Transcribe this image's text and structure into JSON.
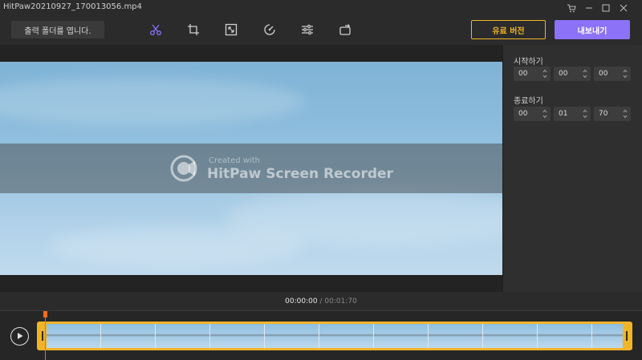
{
  "window": {
    "title": "HitPaw20210927_170013056.mp4",
    "cart_icon": "cart-icon",
    "minimize_icon": "minimize-icon",
    "maximize_icon": "maximize-icon",
    "close_icon": "close-icon"
  },
  "toolbar": {
    "open_folder_label": "출력 폴더를 엽니다.",
    "tools": [
      "cut-icon",
      "crop-icon",
      "resize-icon",
      "speed-icon",
      "adjust-icon",
      "rotate-icon"
    ],
    "active_tool": "cut-icon",
    "pro_label": "유료 버전",
    "export_label": "내보내기"
  },
  "preview": {
    "watermark_small": "Created with",
    "watermark_big": "HitPaw Screen Recorder"
  },
  "trim": {
    "start_label": "시작하기",
    "start": [
      "00",
      "00",
      "00"
    ],
    "end_label": "종료하기",
    "end": [
      "00",
      "01",
      "70"
    ]
  },
  "timecode": {
    "current": "00:00:00",
    "separator": "/",
    "total": "00:01:70"
  },
  "colors": {
    "accent": "#8b72f7",
    "pro": "#f0b429",
    "playhead": "#f36b1c"
  }
}
